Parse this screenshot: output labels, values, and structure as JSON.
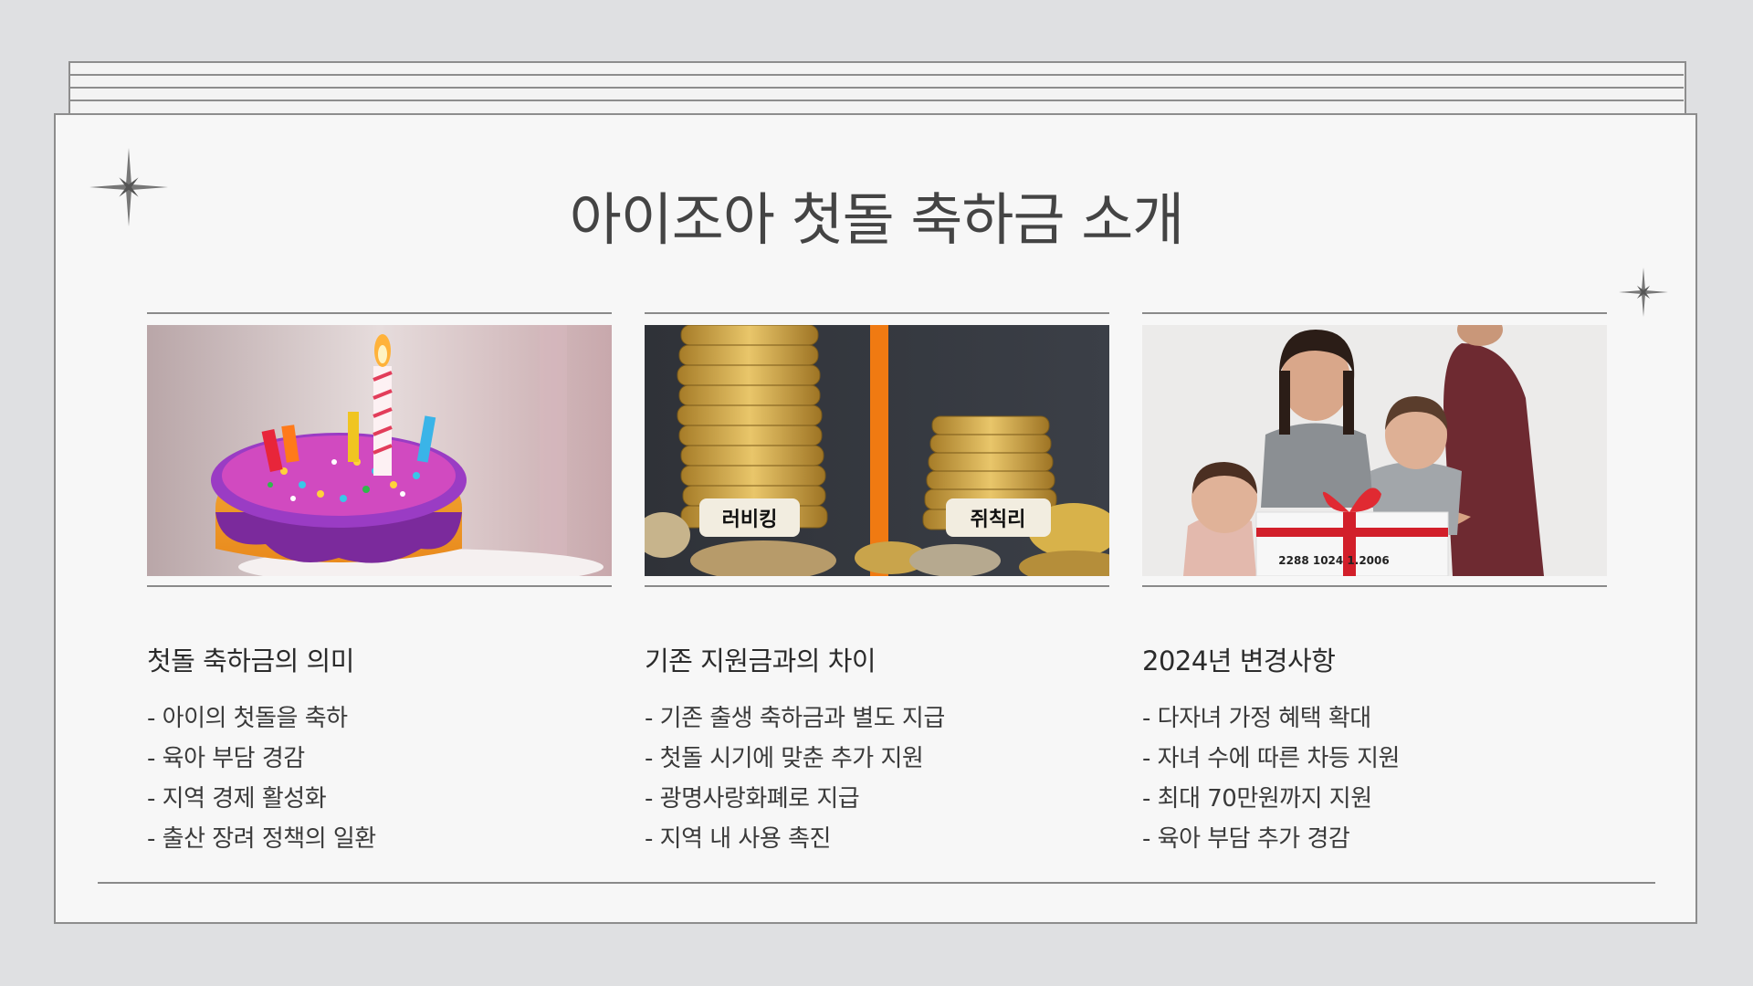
{
  "title": "아이조아 첫돌 축하금 소개",
  "columns": [
    {
      "heading": "첫돌 축하금의 의미",
      "image": "birthday-cake-photo",
      "items": [
        "- 아이의 첫돌을 축하",
        "- 육아 부담 경감",
        "- 지역 경제 활성화",
        "- 출산 장려 정책의 일환"
      ]
    },
    {
      "heading": "기존 지원금과의 차이",
      "image": "coin-stacks-photo",
      "image_labels": [
        "러비킹",
        "쥐칙리"
      ],
      "items": [
        "- 기존 출생 축하금과 별도 지급",
        "- 첫돌 시기에 맞춘 추가 지원",
        "- 광명사랑화폐로 지급",
        "- 지역 내 사용 촉진"
      ]
    },
    {
      "heading": "2024년 변경사항",
      "image": "family-gift-photo",
      "image_labels": [
        "2288 1024 1.2006"
      ],
      "items": [
        "- 다자녀 가정 혜택 확대",
        "- 자녀 수에 따른 차등 지원",
        "- 최대 70만원까지 지원",
        "- 육아 부담 추가 경감"
      ]
    }
  ]
}
